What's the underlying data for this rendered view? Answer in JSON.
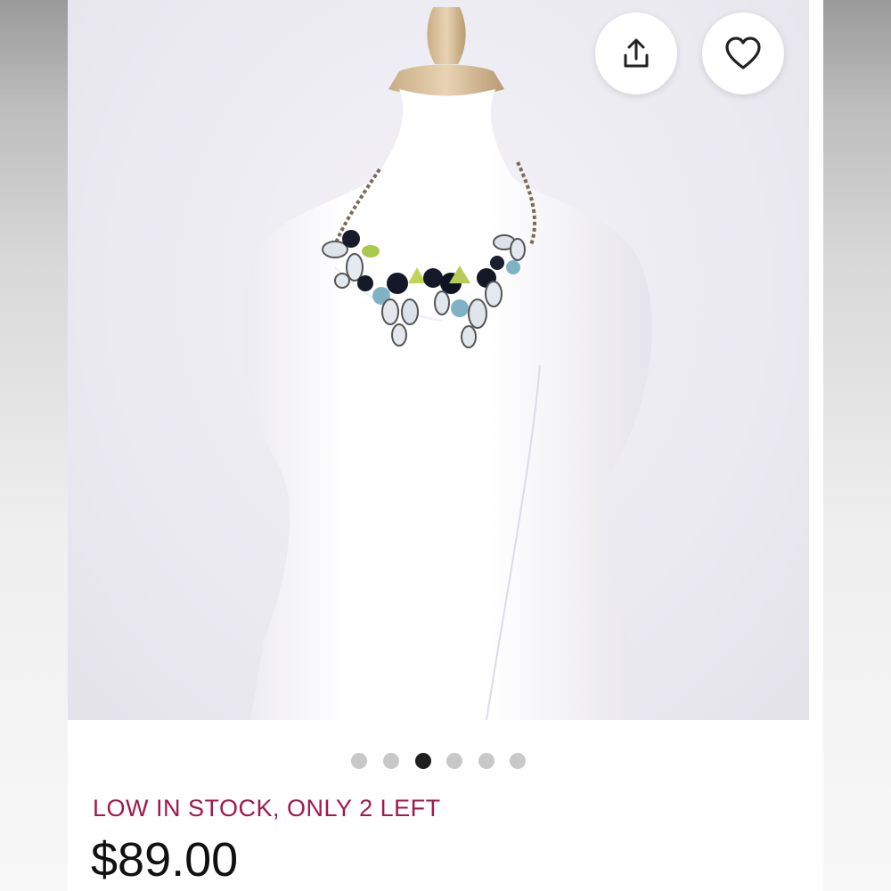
{
  "listing": {
    "image_alt": "Statement necklace on white dress form",
    "stock_text": "LOW IN STOCK, ONLY 2 LEFT",
    "price": "$89.00"
  },
  "actions": {
    "share_icon": "share-icon",
    "like_icon": "heart-icon"
  },
  "carousel": {
    "total": 6,
    "active_index": 2
  },
  "colors": {
    "stock_text": "#a4174a",
    "price_text": "#111111",
    "dot_inactive": "#c8c8c8",
    "dot_active": "#1f1f1f"
  }
}
